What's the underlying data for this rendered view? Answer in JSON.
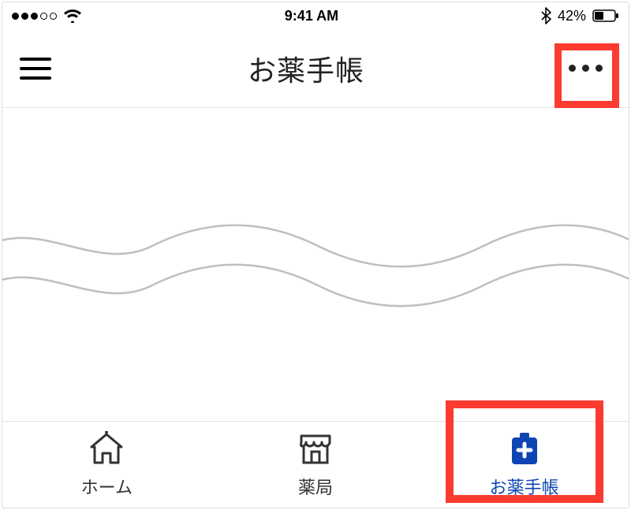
{
  "status_bar": {
    "signal_filled": 3,
    "signal_total": 5,
    "time": "9:41 AM",
    "battery_pct": "42%"
  },
  "nav": {
    "title": "お薬手帳"
  },
  "tabs": [
    {
      "label": "ホーム",
      "active": false
    },
    {
      "label": "薬局",
      "active": false
    },
    {
      "label": "お薬手帳",
      "active": true
    }
  ],
  "colors": {
    "highlight": "#fb3b2f",
    "accent": "#0e45b4"
  }
}
